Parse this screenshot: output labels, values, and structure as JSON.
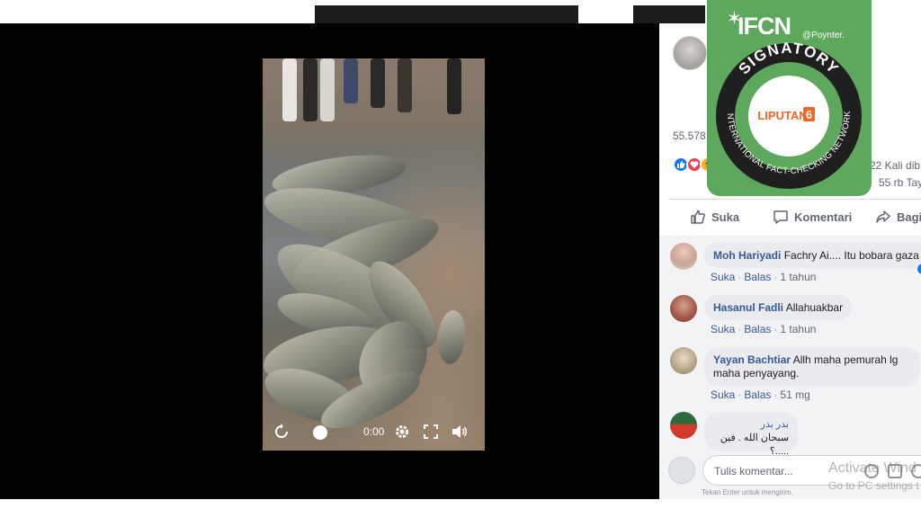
{
  "video": {
    "time": "0:00"
  },
  "post": {
    "views_prefix": "55.578",
    "shares": "ar  22 Kali dib",
    "view_count": "55 rb Tay"
  },
  "actions": {
    "like": "Suka",
    "comment": "Komentari",
    "share": "Bagi"
  },
  "comments": [
    {
      "name": "Moh Hariyadi",
      "text": "Fachry Ai.... Itu bobara gaza",
      "like": "Suka",
      "reply": "Balas",
      "age": "1 tahun"
    },
    {
      "name": "Hasanul Fadli",
      "text": "Allahuakbar",
      "like": "Suka",
      "reply": "Balas",
      "age": "1 tahun"
    },
    {
      "name": "Yayan Bachtiar",
      "text": "Allh maha pemurah lg maha penyayang.",
      "like": "Suka",
      "reply": "Balas",
      "age": "51 mg"
    },
    {
      "name": "بدر بدر",
      "text": "سبحان الله . فين .....؟",
      "like": "",
      "reply": "",
      "age": ""
    }
  ],
  "composer": {
    "placeholder": "Tulis komentar...",
    "hint": "Tekan Enter untuk mengirim."
  },
  "watermark": {
    "line1": "Activate Wind",
    "line2": "Go to PC settings t"
  },
  "badge": {
    "logo": "IFCN",
    "poynter": "@Poynter.",
    "signatory": "SIGNATORY",
    "network": "INTERNATIONAL FACT-CHECKING NETWORK",
    "outlet": "LIPUTAN",
    "outlet_num": "6",
    "colors": {
      "green": "#5ea85d",
      "dark": "#1f1f1f",
      "orange": "#f26522"
    }
  }
}
